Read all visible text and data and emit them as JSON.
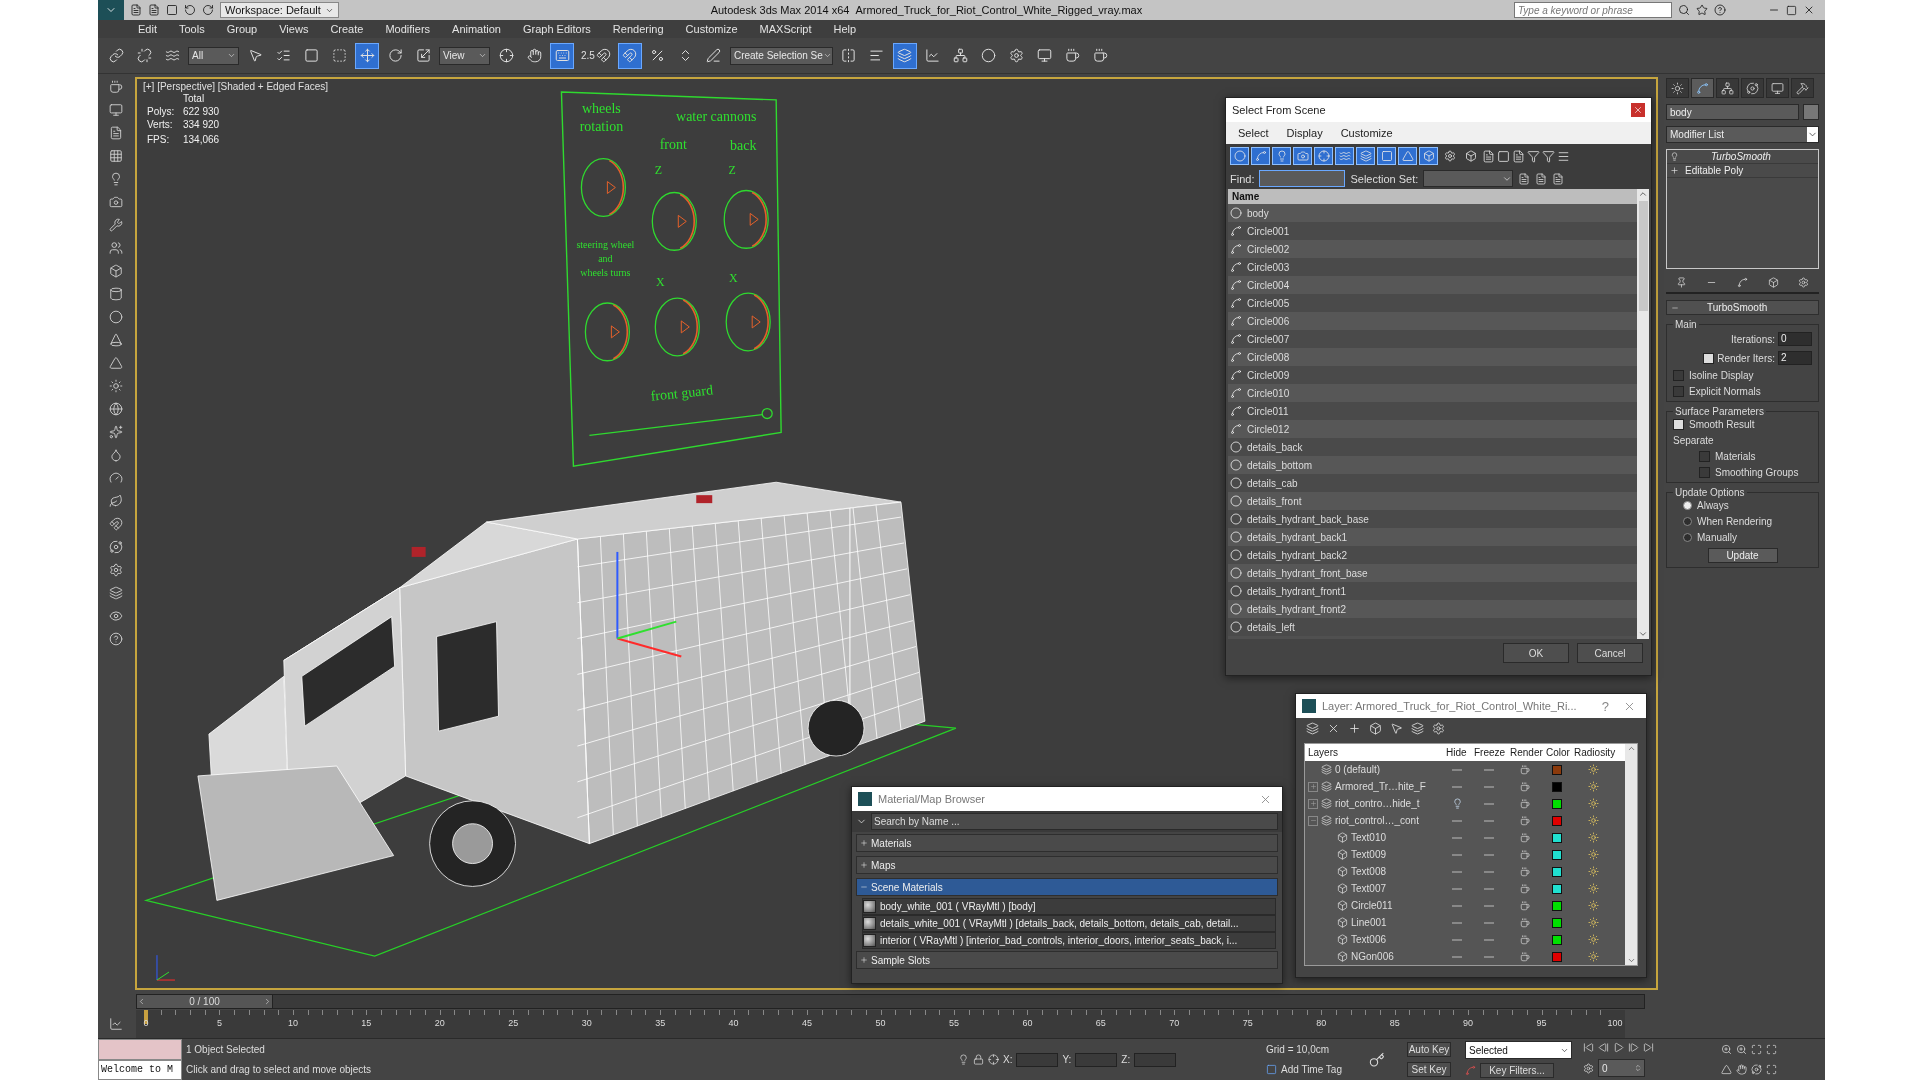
{
  "title_bar": {
    "workspace": "Workspace: Default",
    "app": "Autodesk 3ds Max  2014 x64",
    "file": "Armored_Truck_for_Riot_Control_White_Rigged_vray.max",
    "search_placeholder": "Type a keyword or phrase"
  },
  "menu": [
    "Edit",
    "Tools",
    "Group",
    "Views",
    "Create",
    "Modifiers",
    "Animation",
    "Graph Editors",
    "Rendering",
    "Customize",
    "MAXScript",
    "Help"
  ],
  "toolbar": [
    {
      "kind": "link",
      "active": false
    },
    {
      "kind": "unlink",
      "active": false
    },
    {
      "kind": "bind",
      "active": false
    },
    {
      "kind": "dropdown",
      "value": "All"
    },
    {
      "kind": "select",
      "active": false
    },
    {
      "kind": "select-by-name",
      "active": false
    },
    {
      "kind": "rect-region",
      "active": false
    },
    {
      "kind": "crossing",
      "active": false
    },
    {
      "kind": "move",
      "active": true
    },
    {
      "kind": "rotate",
      "active": false
    },
    {
      "kind": "scale",
      "active": false
    },
    {
      "kind": "dropdown",
      "value": "View"
    },
    {
      "kind": "pivot",
      "active": false
    },
    {
      "kind": "manipulate",
      "active": false
    },
    {
      "kind": "keyboard",
      "active": true
    },
    {
      "kind": "snap",
      "label": "2.5",
      "active": false
    },
    {
      "kind": "angle-snap",
      "active": true
    },
    {
      "kind": "percent-snap",
      "active": false
    },
    {
      "kind": "spinner-snap",
      "active": false
    },
    {
      "kind": "named-sets",
      "active": false
    },
    {
      "kind": "dropdown",
      "value": "Create Selection Se"
    },
    {
      "kind": "mirror",
      "active": false
    },
    {
      "kind": "align",
      "active": false
    },
    {
      "kind": "layers",
      "active": true
    },
    {
      "kind": "curve-editor",
      "active": false
    },
    {
      "kind": "schematic",
      "active": false
    },
    {
      "kind": "material-editor",
      "active": false
    },
    {
      "kind": "render-setup",
      "active": false
    },
    {
      "kind": "frame-window",
      "active": false
    },
    {
      "kind": "render",
      "active": false
    },
    {
      "kind": "render-iterative",
      "active": false
    }
  ],
  "viewport": {
    "label": "[+] [Perspective] [Shaded + Edged Faces]",
    "total": "Total",
    "polys_label": "Polys:",
    "polys": "622 930",
    "verts_label": "Verts:",
    "verts": "334 920",
    "fps_label": "FPS:",
    "fps": "134,066",
    "panel": {
      "wheels": [
        "wheels",
        "rotation"
      ],
      "cannons": "water cannons",
      "front": "front",
      "back": "back",
      "z_labels": [
        "Z",
        "Z"
      ],
      "steering": [
        "steering wheel",
        "and",
        "wheels turns"
      ],
      "x_labels": [
        "X",
        "X"
      ],
      "guard": "front guard"
    }
  },
  "select_dialog": {
    "title": "Select From Scene",
    "menu": [
      "Select",
      "Display",
      "Customize"
    ],
    "filters": [
      {
        "on": true
      },
      {
        "on": true
      },
      {
        "on": true
      },
      {
        "on": true
      },
      {
        "on": true
      },
      {
        "on": true
      },
      {
        "on": true
      },
      {
        "on": true
      },
      {
        "on": true
      },
      {
        "on": true
      },
      {
        "on": false
      },
      {
        "on": false
      }
    ],
    "find_label": "Find:",
    "set_label": "Selection Set:",
    "column": "Name",
    "rows": [
      {
        "name": "body",
        "kind": "geometry"
      },
      {
        "name": "Circle001",
        "kind": "shape"
      },
      {
        "name": "Circle002",
        "kind": "shape"
      },
      {
        "name": "Circle003",
        "kind": "shape"
      },
      {
        "name": "Circle004",
        "kind": "shape"
      },
      {
        "name": "Circle005",
        "kind": "shape"
      },
      {
        "name": "Circle006",
        "kind": "shape"
      },
      {
        "name": "Circle007",
        "kind": "shape"
      },
      {
        "name": "Circle008",
        "kind": "shape"
      },
      {
        "name": "Circle009",
        "kind": "shape"
      },
      {
        "name": "Circle010",
        "kind": "shape"
      },
      {
        "name": "Circle011",
        "kind": "shape"
      },
      {
        "name": "Circle012",
        "kind": "shape"
      },
      {
        "name": "details_back",
        "kind": "geometry"
      },
      {
        "name": "details_bottom",
        "kind": "geometry"
      },
      {
        "name": "details_cab",
        "kind": "geometry"
      },
      {
        "name": "details_front",
        "kind": "geometry"
      },
      {
        "name": "details_hydrant_back_base",
        "kind": "geometry"
      },
      {
        "name": "details_hydrant_back1",
        "kind": "geometry"
      },
      {
        "name": "details_hydrant_back2",
        "kind": "geometry"
      },
      {
        "name": "details_hydrant_front_base",
        "kind": "geometry"
      },
      {
        "name": "details_hydrant_front1",
        "kind": "geometry"
      },
      {
        "name": "details_hydrant_front2",
        "kind": "geometry"
      },
      {
        "name": "details_left",
        "kind": "geometry"
      }
    ],
    "ok": "OK",
    "cancel": "Cancel"
  },
  "layer_dialog": {
    "title": "Layer: Armored_Truck_for_Riot_Control_White_Ri...",
    "help": "?",
    "columns": [
      "Layers",
      "Hide",
      "Freeze",
      "Render",
      "Color",
      "Radiosity"
    ],
    "rows": [
      {
        "name": "0 (default)",
        "kind": "layer",
        "color": "#8b3a0c",
        "hidden": false
      },
      {
        "name": "Armored_Tr…hite_F",
        "kind": "layer",
        "color": "#000000",
        "hidden": false,
        "expanded": false
      },
      {
        "name": "riot_contro…hide_t",
        "kind": "layer",
        "color": "#00e000",
        "hidden": true,
        "expanded": false
      },
      {
        "name": "riot_control…_cont",
        "kind": "layer",
        "color": "#e00000",
        "hidden": false,
        "expanded": true,
        "children": [
          {
            "name": "Text010",
            "kind": "object",
            "color": "#20e0d0",
            "hidden": false
          },
          {
            "name": "Text009",
            "kind": "object",
            "color": "#20e0d0",
            "hidden": false
          },
          {
            "name": "Text008",
            "kind": "object",
            "color": "#20e0d0",
            "hidden": false
          },
          {
            "name": "Text007",
            "kind": "object",
            "color": "#20e0d0",
            "hidden": false
          },
          {
            "name": "Circle011",
            "kind": "object",
            "color": "#00e000",
            "hidden": false
          },
          {
            "name": "Line001",
            "kind": "object",
            "color": "#00e000",
            "hidden": false
          },
          {
            "name": "Text006",
            "kind": "object",
            "color": "#00e000",
            "hidden": false
          },
          {
            "name": "NGon006",
            "kind": "object",
            "color": "#e00000",
            "hidden": false
          }
        ]
      }
    ]
  },
  "material_browser": {
    "title": "Material/Map Browser",
    "search_placeholder": "Search by Name ...",
    "sections": [
      {
        "label": "Materials",
        "expanded": false,
        "selected": false
      },
      {
        "label": "Maps",
        "expanded": false,
        "selected": false
      },
      {
        "label": "Scene Materials",
        "expanded": true,
        "selected": true,
        "items": [
          "body_white_001  ( VRayMtl )  [body]",
          "details_white_001 ( VRayMtl ) [details_back, details_bottom, details_cab, detail...",
          "interior ( VRayMtl ) [interior_bad_controls, interior_doors, interior_seats_back, i..."
        ]
      },
      {
        "label": "Sample Slots",
        "expanded": false,
        "selected": false
      }
    ]
  },
  "command_panel": {
    "tabs": [
      {
        "kind": "create",
        "selected": false
      },
      {
        "kind": "modify",
        "selected": true
      },
      {
        "kind": "hierarchy",
        "selected": false
      },
      {
        "kind": "motion",
        "selected": false
      },
      {
        "kind": "display",
        "selected": false
      },
      {
        "kind": "utilities",
        "selected": false
      }
    ],
    "object_name": "body",
    "modifier_list": "Modifier List",
    "stack": [
      {
        "name": "TurboSmooth",
        "kind": "modifier",
        "viewport_off": true
      },
      {
        "name": "Editable Poly",
        "kind": "base",
        "viewport_off": false
      }
    ],
    "rollout": {
      "title": "TurboSmooth",
      "expanded": true,
      "main_label": "Main",
      "iterations_label": "Iterations:",
      "iterations": "0",
      "render_iters": {
        "label": "Render Iters:",
        "value": "2",
        "checked": true
      },
      "options": [
        {
          "label": "Isoline Display",
          "checked": false
        },
        {
          "label": "Explicit Normals",
          "checked": false
        }
      ],
      "surface_label": "Surface Parameters",
      "smooth_result": {
        "label": "Smooth Result",
        "checked": true
      },
      "separate_label": "Separate",
      "separate": [
        {
          "label": "Materials",
          "checked": false
        },
        {
          "label": "Smoothing Groups",
          "checked": false
        }
      ],
      "update_label": "Update Options",
      "update_modes": [
        {
          "label": "Always",
          "selected": true
        },
        {
          "label": "When Rendering",
          "selected": false
        },
        {
          "label": "Manually",
          "selected": false
        }
      ],
      "update_button": "Update"
    }
  },
  "timeline": {
    "frame": "0 / 100",
    "level": 0,
    "ticks": [
      "0",
      "5",
      "10",
      "15",
      "20",
      "25",
      "30",
      "35",
      "40",
      "45",
      "50",
      "55",
      "60",
      "65",
      "70",
      "75",
      "80",
      "85",
      "90",
      "95",
      "100"
    ]
  },
  "status": {
    "prompt": "Welcome to M",
    "selected": "1 Object Selected",
    "hint": "Click and drag to select and move objects",
    "x_label": "X:",
    "y_label": "Y:",
    "z_label": "Z:",
    "grid": "Grid = 10,0cm",
    "add_time_tag": "Add Time Tag",
    "auto_key": "Auto Key",
    "set_key": "Set Key",
    "key_mode": "Selected",
    "key_filters": "Key Filters...",
    "frame": "0"
  }
}
